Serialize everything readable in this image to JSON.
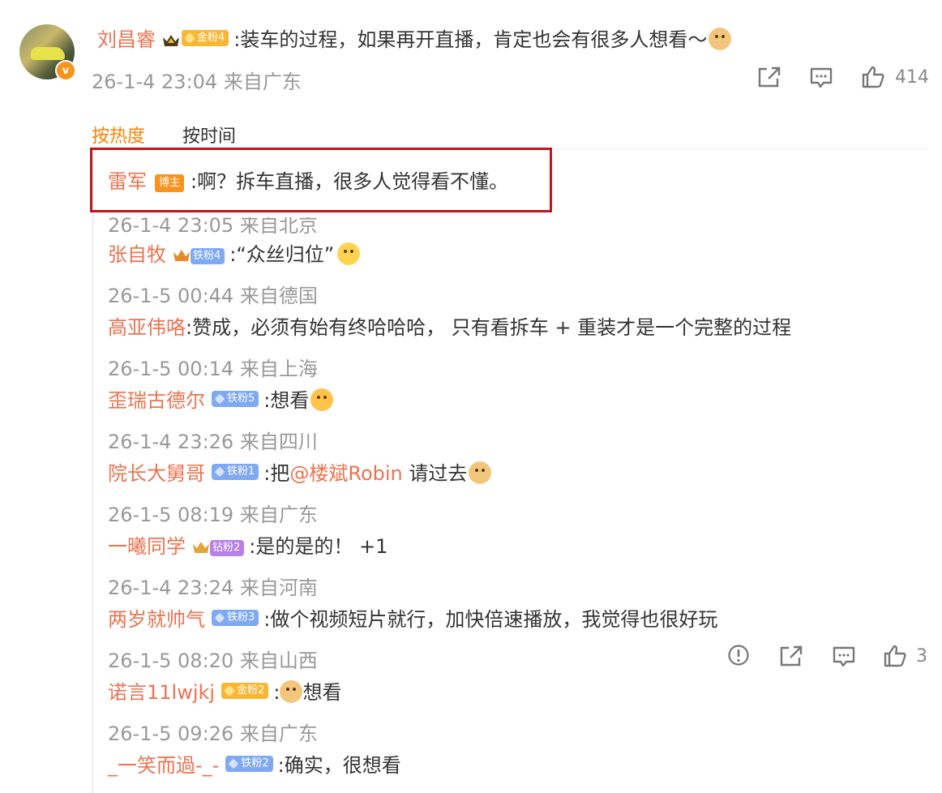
{
  "post": {
    "author": "刘昌睿",
    "fan_badge": "金粉4",
    "text": ":装车的过程，如果再开直播，肯定也会有很多人想看～",
    "meta": "26-1-4 23:04 来自广东",
    "like_count": "414",
    "verified_mark": "v"
  },
  "tabs": {
    "hot": "按热度",
    "time": "按时间"
  },
  "replies": [
    {
      "name": "雷军",
      "tag": "博主",
      "text": ":啊？拆车直播，很多人觉得看不懂。",
      "meta": "26-1-4 23:05 来自北京"
    },
    {
      "name": "张自牧",
      "fan": "铁粉4",
      "text": ":“众丝归位”",
      "meta": "26-1-5 00:44 来自德国"
    },
    {
      "name": "高亚伟咯",
      "text": ":赞成，必须有始有终哈哈哈， 只有看拆车 + 重装才是一个完整的过程",
      "meta": "26-1-5 00:14 来自上海"
    },
    {
      "name": "歪瑞古德尔",
      "fan": "铁粉5",
      "text": ":想看",
      "meta": "26-1-4 23:26 来自四川"
    },
    {
      "name": "院长大舅哥",
      "fan": "铁粉1",
      "text_before": ":把",
      "mention": "@楼斌Robin",
      "text_after": " 请过去",
      "meta": "26-1-5 08:19 来自广东"
    },
    {
      "name": "一曦同学",
      "fan": "钻粉2",
      "text": ":是的是的！ +1",
      "meta": "26-1-4 23:24 来自河南"
    },
    {
      "name": "两岁就帅气",
      "fan": "铁粉3",
      "text": ":做个视频短片就行，加快倍速播放，我觉得也很好玩",
      "meta": "26-1-5 08:20 来自山西",
      "like_count": "3"
    },
    {
      "name": "诺言11lwjkj",
      "fan": "金粉2",
      "text": "想看",
      "meta": "26-1-5 09:26 来自广东"
    },
    {
      "name": "_一笑而過-_-",
      "fan": "铁粉2",
      "text": ":确实，很想看",
      "meta": ""
    }
  ],
  "colors": {
    "name": "#eb7350",
    "meta": "#999999",
    "accent": "#ff8200",
    "highlight": "#c0161a"
  }
}
